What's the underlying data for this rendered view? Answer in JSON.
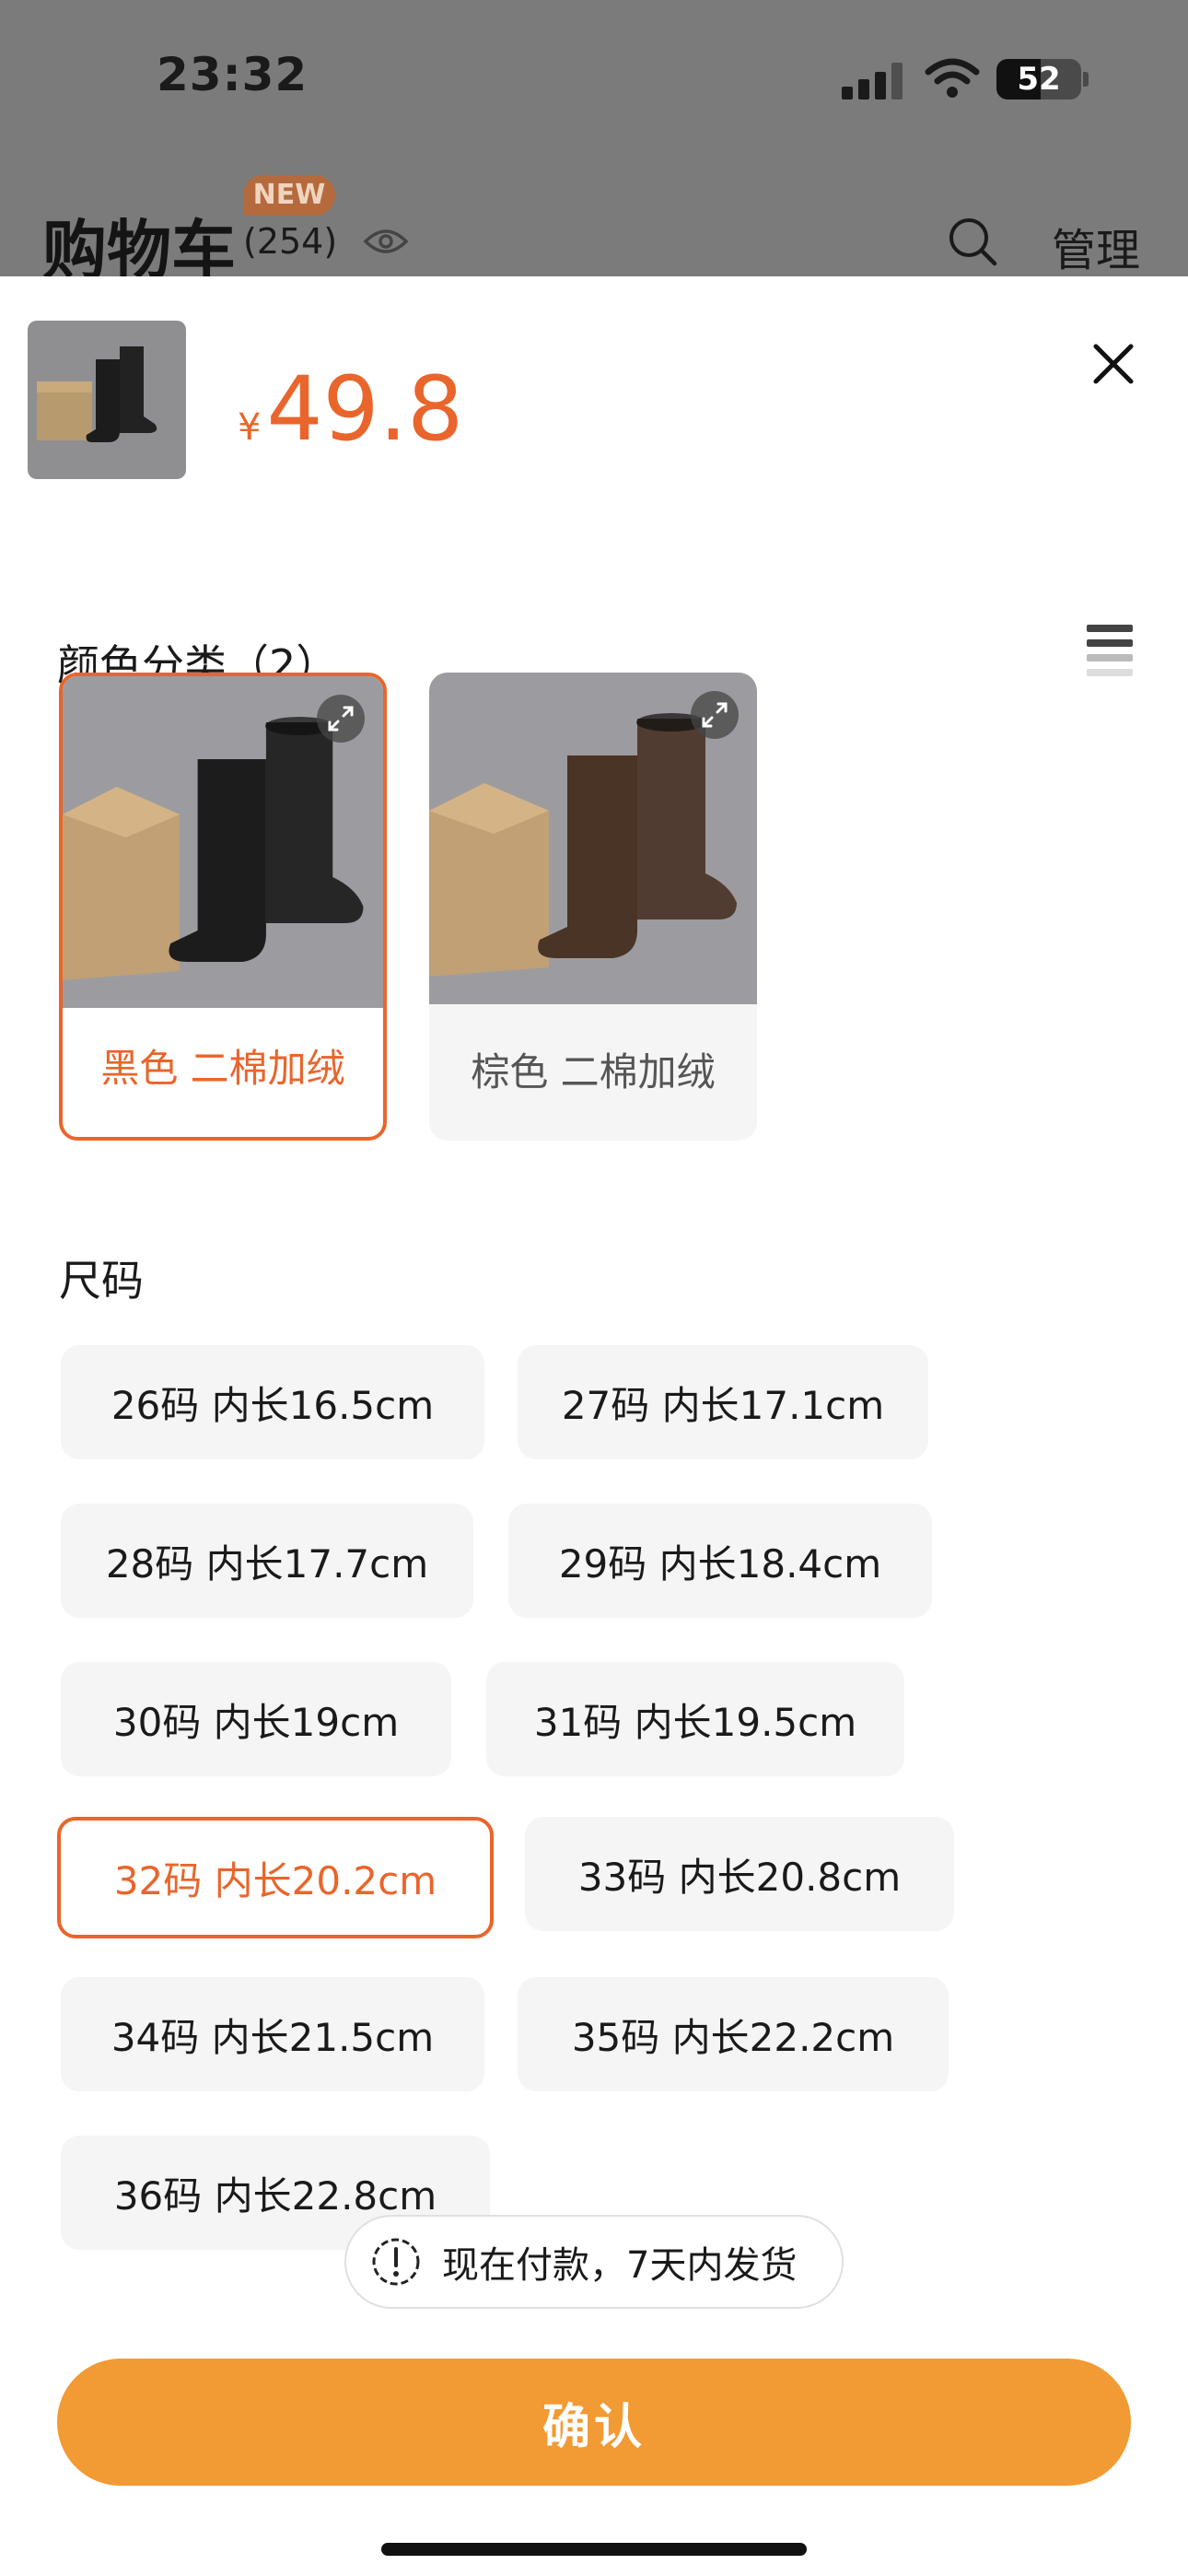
{
  "status_bar": {
    "time": "23:32",
    "battery_level": "52",
    "battery_fraction": 0.52
  },
  "cart_header": {
    "title": "购物车",
    "count": "(254)",
    "badge": "NEW",
    "manage_label": "管理"
  },
  "product": {
    "currency": "¥",
    "price": "49.8"
  },
  "color_section": {
    "label": "颜色分类（2）",
    "options": [
      {
        "label": "黑色 二棉加绒",
        "selected": true,
        "boot_color": "#1c1c1c"
      },
      {
        "label": "棕色 二棉加绒",
        "selected": false,
        "boot_color": "#4a3426"
      }
    ]
  },
  "size_section": {
    "label": "尺码",
    "options": [
      {
        "label": "26码 内长16.5cm",
        "selected": false
      },
      {
        "label": "27码 内长17.1cm",
        "selected": false
      },
      {
        "label": "28码 内长17.7cm",
        "selected": false
      },
      {
        "label": "29码 内长18.4cm",
        "selected": false
      },
      {
        "label": "30码 内长19cm",
        "selected": false
      },
      {
        "label": "31码 内长19.5cm",
        "selected": false
      },
      {
        "label": "32码 内长20.2cm",
        "selected": true
      },
      {
        "label": "33码 内长20.8cm",
        "selected": false
      },
      {
        "label": "34码 内长21.5cm",
        "selected": false
      },
      {
        "label": "35码 内长22.2cm",
        "selected": false
      },
      {
        "label": "36码 内长22.8cm",
        "selected": false
      }
    ]
  },
  "notice": {
    "text": "现在付款，7天内发货"
  },
  "confirm_button": {
    "label": "确认"
  },
  "colors": {
    "accent": "#e9652b",
    "confirm": "#f29a33",
    "chip_bg": "#f5f5f5"
  }
}
